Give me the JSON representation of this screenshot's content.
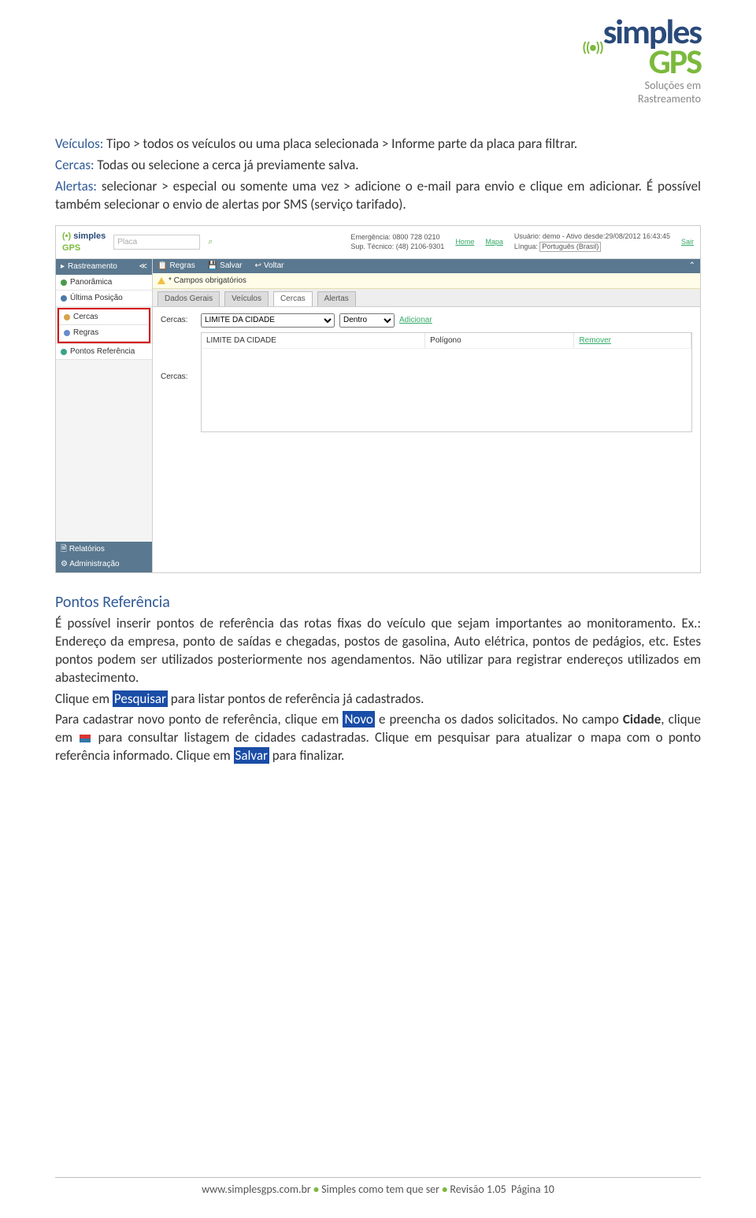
{
  "logo": {
    "line1": "simples",
    "line2": "GPS",
    "tag": "Soluções em\nRastreamento",
    "signal": "((•))"
  },
  "intro": {
    "veiculos_label": "Veículos:",
    "veiculos_text": " Tipo > todos os veículos ou uma placa selecionada > Informe parte da placa para filtrar.",
    "cercas_label": "Cercas:",
    "cercas_text": " Todas ou selecione a cerca já previamente salva.",
    "alertas_label": "Alertas:",
    "alertas_text": " selecionar > especial ou somente uma vez > adicione o e-mail para envio e clique em adicionar. É possível também selecionar o envio de alertas por SMS (serviço tarifado)."
  },
  "shot": {
    "placa_ph": "Placa",
    "top_right": {
      "emerg": "Emergência: 0800 728 0210",
      "sup": "Sup. Técnico: (48) 2106-9301",
      "home": "Home",
      "mapa": "Mapa",
      "user": "Usuário: demo - Ativo desde:29/08/2012 16:43:45",
      "lingua_lbl": "Língua:",
      "lingua_val": "Português (Brasil)",
      "sair": "Sair"
    },
    "side": {
      "hdr": "Rastreamento",
      "panoramica": "Panorâmica",
      "ultima": "Última Posição",
      "cercas": "Cercas",
      "regras": "Regras",
      "pontos": "Pontos Referência",
      "relatorios": "Relatórios",
      "admin": "Administração"
    },
    "toolbar": {
      "regras": "Regras",
      "salvar": "Salvar",
      "voltar": "Voltar"
    },
    "hint": "* Campos obrigatórios",
    "tabs": {
      "dados": "Dados Gerais",
      "veiculos": "Veículos",
      "cercas": "Cercas",
      "alertas": "Alertas"
    },
    "form": {
      "label": "Cercas:",
      "cerca_val": "LIMITE DA CIDADE",
      "pos_val": "Dentro",
      "adicionar": "Adicionar",
      "list_label": "Cercas:",
      "row_col1": "LIMITE DA CIDADE",
      "row_col2": "Polígono",
      "row_col3": "Remover"
    }
  },
  "section2": {
    "heading": "Pontos Referência",
    "p1": "É possível inserir pontos de referência das rotas fixas do veículo que sejam importantes ao monitoramento. Ex.: Endereço da empresa, ponto de saídas e chegadas, postos de gasolina, Auto elétrica, pontos de pedágios, etc. Estes pontos podem ser utilizados posteriormente nos agendamentos. Não utilizar para registrar endereços utilizados em abastecimento.",
    "p2a": "Clique em ",
    "p2_hl": "Pesquisar",
    "p2b": " para listar pontos de referência já cadastrados.",
    "p3a": "Para cadastrar novo ponto de referência, clique em ",
    "p3_hl1": "Novo",
    "p3b": " e preencha os dados solicitados. No campo ",
    "p3_bold": "Cidade",
    "p3c": ", clique em ",
    "p3d": " para consultar listagem de cidades cadastradas. Clique em pesquisar para atualizar o mapa com o ponto referência informado. Clique em ",
    "p3_hl2": "Salvar",
    "p3e": " para finalizar."
  },
  "footer": {
    "site": "www.simplesgps.com.br",
    "mid": "Simples como tem que ser",
    "rev": "Revisão 1.05",
    "page": "Página 10"
  }
}
